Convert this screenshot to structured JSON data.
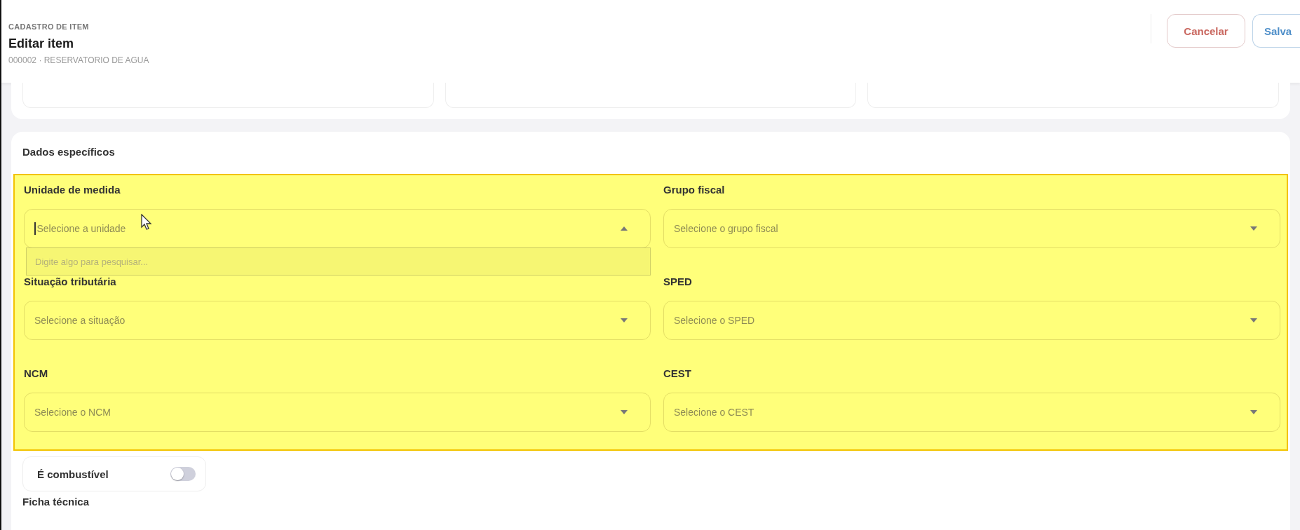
{
  "header": {
    "eyebrow": "CADASTRO DE ITEM",
    "title": "Editar item",
    "subtitle": "000002 · RESERVATORIO DE AGUA",
    "buttons": [
      {
        "label": "Cancelar",
        "kind": "cancel"
      },
      {
        "label": "Salva",
        "kind": "save"
      }
    ]
  },
  "section": {
    "title": "Dados específicos",
    "highlighted": true,
    "fields": [
      {
        "label": "Unidade de medida",
        "placeholder": "Selecione a unidade",
        "expanded": true,
        "search_placeholder": "Digite algo para pesquisar..."
      },
      {
        "label": "Grupo fiscal",
        "placeholder": "Selecione o grupo fiscal",
        "expanded": false
      },
      {
        "label": "Situação tributária",
        "placeholder": "Selecione a situação",
        "expanded": false
      },
      {
        "label": "SPED",
        "placeholder": "Selecione o SPED",
        "expanded": false
      },
      {
        "label": "NCM",
        "placeholder": "Selecione o NCM",
        "expanded": false
      },
      {
        "label": "CEST",
        "placeholder": "Selecione o CEST",
        "expanded": false
      }
    ]
  },
  "toggles": [
    {
      "label": "É combustível",
      "on": false
    }
  ],
  "next_section": {
    "title": "Ficha técnica"
  }
}
